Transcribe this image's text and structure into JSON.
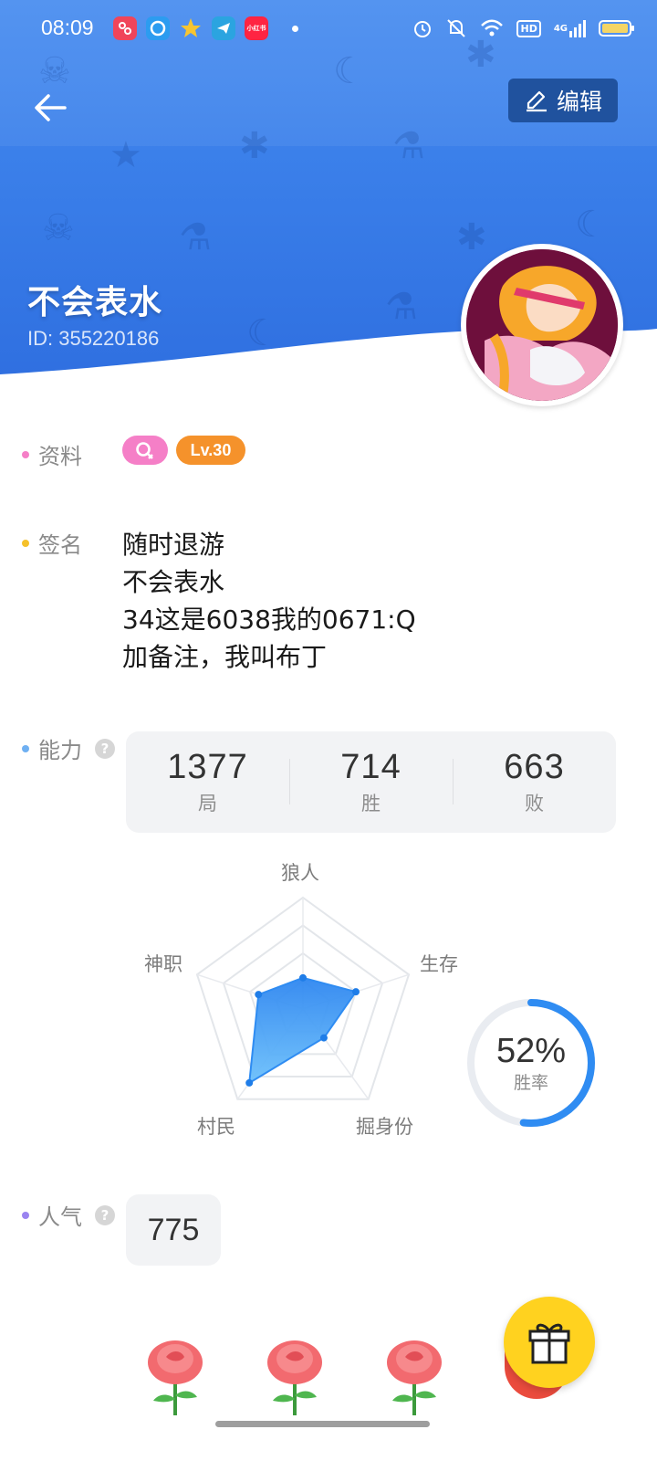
{
  "status_bar": {
    "time": "08:09",
    "network": "4G",
    "hd": "HD",
    "notif_apps": [
      "app-video-icon",
      "app-browser-icon",
      "app-star-icon",
      "app-telegram-icon",
      "app-xiaohongshu-icon"
    ],
    "xhs_label": "小红书"
  },
  "header": {
    "edit_label": "编辑",
    "nickname": "不会表水",
    "user_id": "ID: 355220186"
  },
  "profile": {
    "info_label": "资料",
    "level_badge": "Lv.30",
    "signature_label": "签名",
    "signature_lines": [
      "随时退游",
      "不会表水",
      "34这是6038我的0671:Q",
      "加备注，我叫布丁"
    ],
    "ability_label": "能力",
    "popularity_label": "人气",
    "popularity_value": "775",
    "help_glyph": "?"
  },
  "stats": [
    {
      "value": "1377",
      "label": "局"
    },
    {
      "value": "714",
      "label": "胜"
    },
    {
      "value": "663",
      "label": "败"
    }
  ],
  "radar": {
    "axes": [
      "狼人",
      "生存",
      "掘身份",
      "村民",
      "神职"
    ],
    "values": [
      0.28,
      0.5,
      0.32,
      0.82,
      0.42
    ]
  },
  "win_rate": {
    "value": "52%",
    "fraction": 0.52,
    "label": "胜率"
  },
  "colors": {
    "header_blue": "#3b80ea",
    "accent_blue": "#2f8cf2",
    "dot_pink": "#f57fc7",
    "dot_yellow": "#f5c12b",
    "dot_blue": "#6fb0f2",
    "dot_purple": "#9a84f0",
    "level_orange": "#f5922b",
    "gift_yellow": "#ffd21f"
  }
}
